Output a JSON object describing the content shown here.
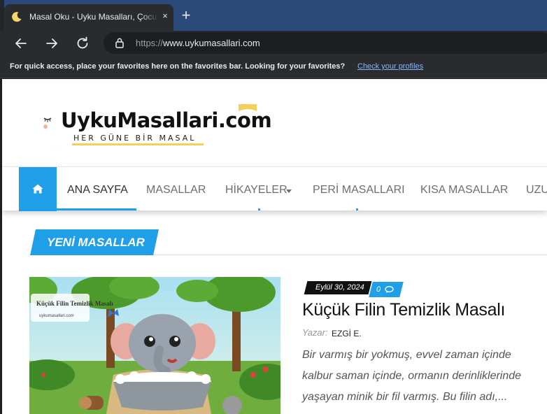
{
  "browser": {
    "tab_title": "Masal Oku - Uyku Masalları, Çocuk",
    "close_symbol": "×",
    "new_tab_symbol": "+",
    "url_prefix": "https://",
    "url_domain": "www.uykumasallari.com",
    "favorites_message": "For quick access, place your favorites here on the favorites bar. Looking for your favorites?",
    "favorites_link": "Check your profiles",
    "icons": [
      "moon-favicon",
      "back-arrow-icon",
      "forward-arrow-icon",
      "refresh-icon",
      "lock-icon"
    ]
  },
  "site": {
    "logo_text": "UykuMasallari.com",
    "logo_tagline": "HER GÜNE BİR MASAL",
    "accent_color": "#1f9fe8",
    "menu": [
      {
        "label": "ANA SAYFA",
        "active": true
      },
      {
        "label": "MASALLAR",
        "active": false
      },
      {
        "label": "HİKAYELER",
        "dropdown": true,
        "active": false
      },
      {
        "label": "PERİ MASALLARI",
        "active": false
      },
      {
        "label": "KISA MASALLAR",
        "active": false
      },
      {
        "label": "UZU",
        "active": false
      }
    ],
    "home_icon": "home-icon",
    "section_title": "YENİ MASALLAR"
  },
  "post": {
    "image_caption_title": "Küçük Filin Temizlik Masalı",
    "image_caption_site": "uykumasallari.com",
    "date": "Eylül 30, 2024",
    "comment_count": "0",
    "title": "Küçük Filin Temizlik Masalı",
    "author_label": "Yazar:",
    "author": "EZGİ E.",
    "excerpt": "Bir varmış bir yokmuş, evvel zaman içinde kalbur saman içinde, ormanın derinliklerinde yaşayan minik bir fil varmış. Bu filin adı,..."
  }
}
